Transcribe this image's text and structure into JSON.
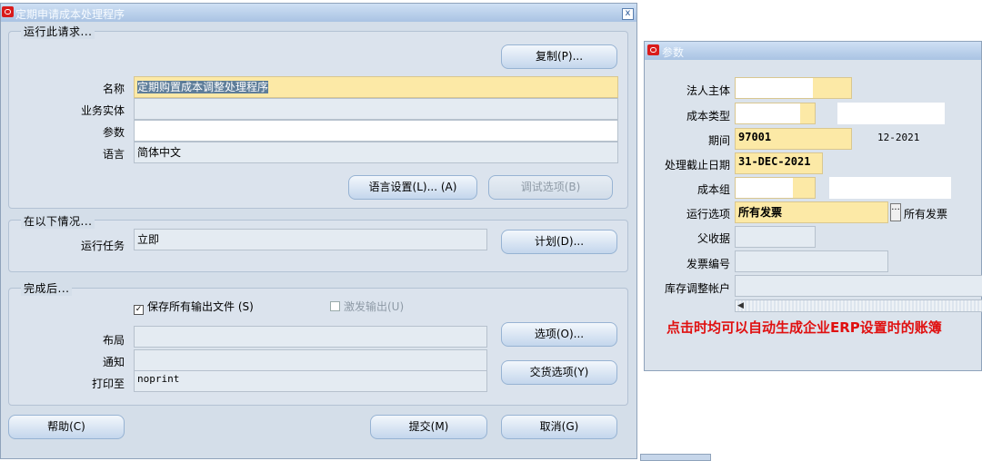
{
  "main_window": {
    "title": "定期申请成本处理程序",
    "close_glyph": "x",
    "run_group": {
      "title": "运行此请求...",
      "copy_button": "复制(P)...",
      "name_label": "名称",
      "name_value": "定期购置成本调整处理程序",
      "operating_unit_label": "业务实体",
      "operating_unit_value": "",
      "parameters_label": "参数",
      "parameters_value": "",
      "language_label": "语言",
      "language_value": "简体中文",
      "language_settings_button": "语言设置(L)...  (A)",
      "debug_options_button": "调试选项(B)"
    },
    "schedule_group": {
      "title": "在以下情况...",
      "run_job_label": "运行任务",
      "run_job_value": "立即",
      "schedule_button": "计划(D)..."
    },
    "completion_group": {
      "title": "完成后...",
      "save_output_label": "保存所有输出文件 (S)",
      "save_output_checked": true,
      "burst_output_label": "激发输出(U)",
      "burst_output_checked": false,
      "layout_label": "布局",
      "layout_value": "",
      "notify_label": "通知",
      "notify_value": "",
      "print_to_label": "打印至",
      "print_to_value": "noprint",
      "options_button": "选项(O)...",
      "delivery_options_button": "交货选项(Y)"
    },
    "help_button": "帮助(C)",
    "submit_button": "提交(M)",
    "cancel_button": "取消(G)"
  },
  "params_window": {
    "title": "参数",
    "fields": {
      "legal_entity_label": "法人主体",
      "legal_entity_value": "",
      "cost_type_label": "成本类型",
      "cost_type_value": "",
      "cost_type_desc": "",
      "period_label": "期间",
      "period_value": "97001",
      "period_desc": "12-2021",
      "cutoff_date_label": "处理截止日期",
      "cutoff_date_value": "31-DEC-2021",
      "cost_group_label": "成本组",
      "cost_group_value": "",
      "cost_group_desc": "",
      "run_option_label": "运行选项",
      "run_option_value": "所有发票",
      "run_option_desc": "所有发票",
      "ellipsis": "···",
      "parent_receipt_label": "父收据",
      "parent_receipt_value": "",
      "invoice_number_label": "发票编号",
      "invoice_number_value": "",
      "inventory_adj_account_label": "库存调整帐户",
      "inventory_adj_account_value": ""
    },
    "scroll_arrow": "◀",
    "annotation": "点击时均可以自动生成企业ERP设置时的账簿"
  },
  "colors": {
    "window_bg": "#d4dee9",
    "required_field": "#fce9a6",
    "annotation": "#e01010",
    "oracle_icon": "#d91b1b"
  }
}
